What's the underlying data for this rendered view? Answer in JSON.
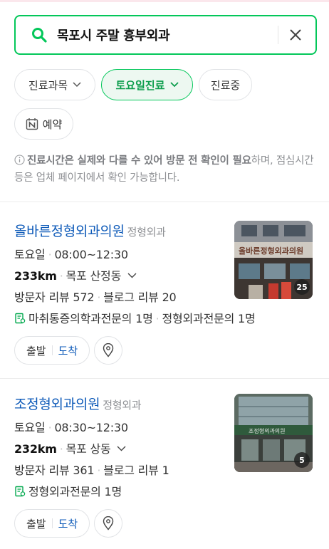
{
  "search": {
    "query": "목포시 주말 흉부외과"
  },
  "filters": {
    "department": "진료과목",
    "saturday": "토요일진료",
    "open_now": "진료중",
    "reservation": "예약"
  },
  "notice": {
    "bold_text": "진료시간은 실제와 다를 수 있어 방문 전 확인이 필요",
    "rest_text": "하며, 점심시간 등은 업체 페이지에서 확인 가능합니다."
  },
  "results": [
    {
      "name": "올바른정형외과의원",
      "category": "정형외과",
      "day": "토요일",
      "hours": "08:00~12:30",
      "distance": "233km",
      "area": "목포 산정동",
      "visitor_reviews": "방문자 리뷰 572",
      "blog_reviews": "블로그 리뷰 20",
      "specialists": [
        "마취통증의학과전문의 1명",
        "정형외과전문의 1명"
      ],
      "photo_count": "25",
      "depart_label": "출발",
      "arrive_label": "도착"
    },
    {
      "name": "조정형외과의원",
      "category": "정형외과",
      "day": "토요일",
      "hours": "08:30~12:30",
      "distance": "232km",
      "area": "목포 상동",
      "visitor_reviews": "방문자 리뷰 361",
      "blog_reviews": "블로그 리뷰 1",
      "specialists": [
        "정형외과전문의 1명"
      ],
      "photo_count": "5",
      "depart_label": "출발",
      "arrive_label": "도착"
    }
  ],
  "colors": {
    "accent": "#03c75a",
    "link": "#0c59b8"
  }
}
